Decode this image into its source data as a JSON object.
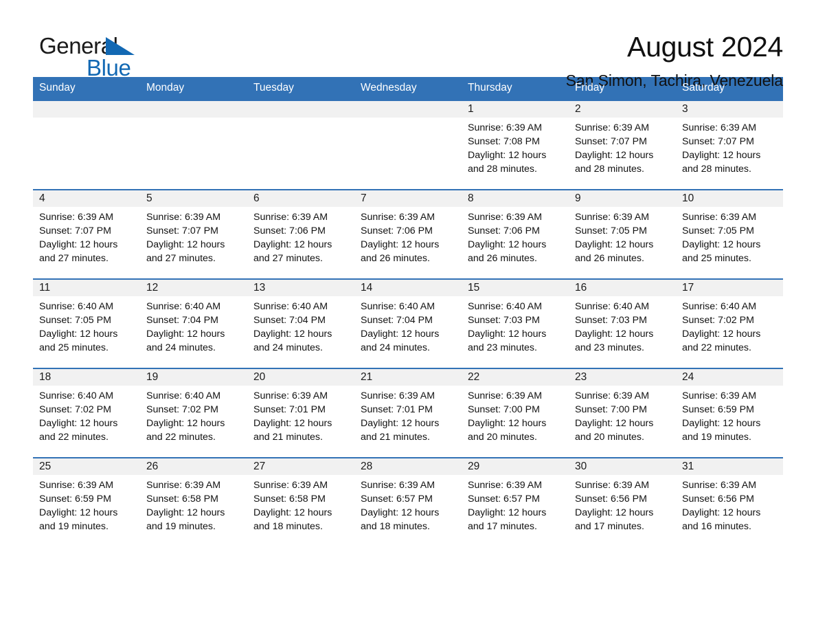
{
  "logo": {
    "word_one": "General",
    "word_two": "Blue",
    "triangle_color": "#1268b3"
  },
  "header": {
    "title": "August 2024",
    "subtitle": "San Simon, Tachira, Venezuela"
  },
  "theme": {
    "header_blue": "#3272b6",
    "daynum_band": "#f1f1f1",
    "text": "#111111"
  },
  "weekday_headers": [
    "Sunday",
    "Monday",
    "Tuesday",
    "Wednesday",
    "Thursday",
    "Friday",
    "Saturday"
  ],
  "labels": {
    "sunrise_prefix": "Sunrise:",
    "sunset_prefix": "Sunset:",
    "daylight_prefix": "Daylight:"
  },
  "weeks": [
    [
      {
        "blank": true,
        "day": ""
      },
      {
        "blank": true,
        "day": ""
      },
      {
        "blank": true,
        "day": ""
      },
      {
        "blank": true,
        "day": ""
      },
      {
        "blank": false,
        "day": "1",
        "sunrise": "Sunrise: 6:39 AM",
        "sunset": "Sunset: 7:08 PM",
        "daylight_line1": "Daylight: 12 hours",
        "daylight_line2": "and 28 minutes."
      },
      {
        "blank": false,
        "day": "2",
        "sunrise": "Sunrise: 6:39 AM",
        "sunset": "Sunset: 7:07 PM",
        "daylight_line1": "Daylight: 12 hours",
        "daylight_line2": "and 28 minutes."
      },
      {
        "blank": false,
        "day": "3",
        "sunrise": "Sunrise: 6:39 AM",
        "sunset": "Sunset: 7:07 PM",
        "daylight_line1": "Daylight: 12 hours",
        "daylight_line2": "and 28 minutes."
      }
    ],
    [
      {
        "blank": false,
        "day": "4",
        "sunrise": "Sunrise: 6:39 AM",
        "sunset": "Sunset: 7:07 PM",
        "daylight_line1": "Daylight: 12 hours",
        "daylight_line2": "and 27 minutes."
      },
      {
        "blank": false,
        "day": "5",
        "sunrise": "Sunrise: 6:39 AM",
        "sunset": "Sunset: 7:07 PM",
        "daylight_line1": "Daylight: 12 hours",
        "daylight_line2": "and 27 minutes."
      },
      {
        "blank": false,
        "day": "6",
        "sunrise": "Sunrise: 6:39 AM",
        "sunset": "Sunset: 7:06 PM",
        "daylight_line1": "Daylight: 12 hours",
        "daylight_line2": "and 27 minutes."
      },
      {
        "blank": false,
        "day": "7",
        "sunrise": "Sunrise: 6:39 AM",
        "sunset": "Sunset: 7:06 PM",
        "daylight_line1": "Daylight: 12 hours",
        "daylight_line2": "and 26 minutes."
      },
      {
        "blank": false,
        "day": "8",
        "sunrise": "Sunrise: 6:39 AM",
        "sunset": "Sunset: 7:06 PM",
        "daylight_line1": "Daylight: 12 hours",
        "daylight_line2": "and 26 minutes."
      },
      {
        "blank": false,
        "day": "9",
        "sunrise": "Sunrise: 6:39 AM",
        "sunset": "Sunset: 7:05 PM",
        "daylight_line1": "Daylight: 12 hours",
        "daylight_line2": "and 26 minutes."
      },
      {
        "blank": false,
        "day": "10",
        "sunrise": "Sunrise: 6:39 AM",
        "sunset": "Sunset: 7:05 PM",
        "daylight_line1": "Daylight: 12 hours",
        "daylight_line2": "and 25 minutes."
      }
    ],
    [
      {
        "blank": false,
        "day": "11",
        "sunrise": "Sunrise: 6:40 AM",
        "sunset": "Sunset: 7:05 PM",
        "daylight_line1": "Daylight: 12 hours",
        "daylight_line2": "and 25 minutes."
      },
      {
        "blank": false,
        "day": "12",
        "sunrise": "Sunrise: 6:40 AM",
        "sunset": "Sunset: 7:04 PM",
        "daylight_line1": "Daylight: 12 hours",
        "daylight_line2": "and 24 minutes."
      },
      {
        "blank": false,
        "day": "13",
        "sunrise": "Sunrise: 6:40 AM",
        "sunset": "Sunset: 7:04 PM",
        "daylight_line1": "Daylight: 12 hours",
        "daylight_line2": "and 24 minutes."
      },
      {
        "blank": false,
        "day": "14",
        "sunrise": "Sunrise: 6:40 AM",
        "sunset": "Sunset: 7:04 PM",
        "daylight_line1": "Daylight: 12 hours",
        "daylight_line2": "and 24 minutes."
      },
      {
        "blank": false,
        "day": "15",
        "sunrise": "Sunrise: 6:40 AM",
        "sunset": "Sunset: 7:03 PM",
        "daylight_line1": "Daylight: 12 hours",
        "daylight_line2": "and 23 minutes."
      },
      {
        "blank": false,
        "day": "16",
        "sunrise": "Sunrise: 6:40 AM",
        "sunset": "Sunset: 7:03 PM",
        "daylight_line1": "Daylight: 12 hours",
        "daylight_line2": "and 23 minutes."
      },
      {
        "blank": false,
        "day": "17",
        "sunrise": "Sunrise: 6:40 AM",
        "sunset": "Sunset: 7:02 PM",
        "daylight_line1": "Daylight: 12 hours",
        "daylight_line2": "and 22 minutes."
      }
    ],
    [
      {
        "blank": false,
        "day": "18",
        "sunrise": "Sunrise: 6:40 AM",
        "sunset": "Sunset: 7:02 PM",
        "daylight_line1": "Daylight: 12 hours",
        "daylight_line2": "and 22 minutes."
      },
      {
        "blank": false,
        "day": "19",
        "sunrise": "Sunrise: 6:40 AM",
        "sunset": "Sunset: 7:02 PM",
        "daylight_line1": "Daylight: 12 hours",
        "daylight_line2": "and 22 minutes."
      },
      {
        "blank": false,
        "day": "20",
        "sunrise": "Sunrise: 6:39 AM",
        "sunset": "Sunset: 7:01 PM",
        "daylight_line1": "Daylight: 12 hours",
        "daylight_line2": "and 21 minutes."
      },
      {
        "blank": false,
        "day": "21",
        "sunrise": "Sunrise: 6:39 AM",
        "sunset": "Sunset: 7:01 PM",
        "daylight_line1": "Daylight: 12 hours",
        "daylight_line2": "and 21 minutes."
      },
      {
        "blank": false,
        "day": "22",
        "sunrise": "Sunrise: 6:39 AM",
        "sunset": "Sunset: 7:00 PM",
        "daylight_line1": "Daylight: 12 hours",
        "daylight_line2": "and 20 minutes."
      },
      {
        "blank": false,
        "day": "23",
        "sunrise": "Sunrise: 6:39 AM",
        "sunset": "Sunset: 7:00 PM",
        "daylight_line1": "Daylight: 12 hours",
        "daylight_line2": "and 20 minutes."
      },
      {
        "blank": false,
        "day": "24",
        "sunrise": "Sunrise: 6:39 AM",
        "sunset": "Sunset: 6:59 PM",
        "daylight_line1": "Daylight: 12 hours",
        "daylight_line2": "and 19 minutes."
      }
    ],
    [
      {
        "blank": false,
        "day": "25",
        "sunrise": "Sunrise: 6:39 AM",
        "sunset": "Sunset: 6:59 PM",
        "daylight_line1": "Daylight: 12 hours",
        "daylight_line2": "and 19 minutes."
      },
      {
        "blank": false,
        "day": "26",
        "sunrise": "Sunrise: 6:39 AM",
        "sunset": "Sunset: 6:58 PM",
        "daylight_line1": "Daylight: 12 hours",
        "daylight_line2": "and 19 minutes."
      },
      {
        "blank": false,
        "day": "27",
        "sunrise": "Sunrise: 6:39 AM",
        "sunset": "Sunset: 6:58 PM",
        "daylight_line1": "Daylight: 12 hours",
        "daylight_line2": "and 18 minutes."
      },
      {
        "blank": false,
        "day": "28",
        "sunrise": "Sunrise: 6:39 AM",
        "sunset": "Sunset: 6:57 PM",
        "daylight_line1": "Daylight: 12 hours",
        "daylight_line2": "and 18 minutes."
      },
      {
        "blank": false,
        "day": "29",
        "sunrise": "Sunrise: 6:39 AM",
        "sunset": "Sunset: 6:57 PM",
        "daylight_line1": "Daylight: 12 hours",
        "daylight_line2": "and 17 minutes."
      },
      {
        "blank": false,
        "day": "30",
        "sunrise": "Sunrise: 6:39 AM",
        "sunset": "Sunset: 6:56 PM",
        "daylight_line1": "Daylight: 12 hours",
        "daylight_line2": "and 17 minutes."
      },
      {
        "blank": false,
        "day": "31",
        "sunrise": "Sunrise: 6:39 AM",
        "sunset": "Sunset: 6:56 PM",
        "daylight_line1": "Daylight: 12 hours",
        "daylight_line2": "and 16 minutes."
      }
    ]
  ]
}
